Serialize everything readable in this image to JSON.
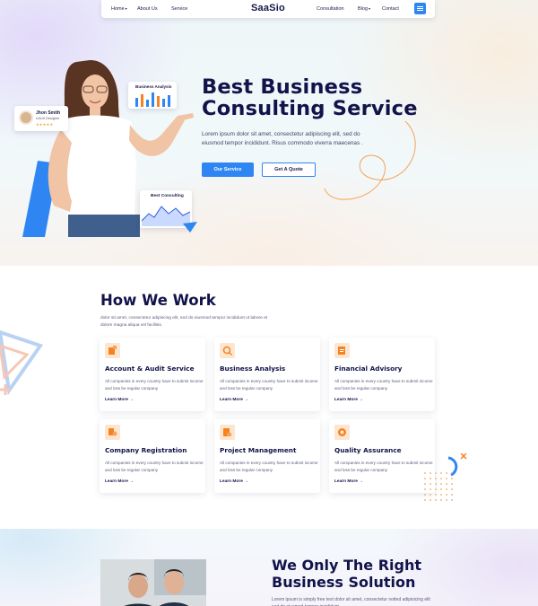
{
  "nav": {
    "items_left": [
      {
        "label": "Home",
        "caret": "▾"
      },
      {
        "label": "About Us",
        "caret": ""
      },
      {
        "label": "Service",
        "caret": ""
      }
    ],
    "logo": "SaaSio",
    "items_right": [
      {
        "label": "Consultation",
        "caret": ""
      },
      {
        "label": "Blog",
        "caret": "▾"
      },
      {
        "label": "Contact",
        "caret": ""
      }
    ],
    "menu_icon": "hamburger-icon"
  },
  "hero": {
    "title": "Best Business Consulting Service",
    "description": "Lorem ipsum dolor sit amet, consectetur adipiscing elit, sed do eiusmod tempor incididunt. Risus commodo viverra maecenas .",
    "primary_button": "Our Service",
    "secondary_button": "Get A Quote",
    "card_analysis_title": "Business Analysis",
    "card_user_name": "Jhon Smith",
    "card_user_role": "UI/UX Designer",
    "card_user_stars": "★★★★★",
    "card_consult_title": "Best Consulting"
  },
  "how_we_work": {
    "title": "How We Work",
    "description": "dolor sit amet, consectetur adipiscing elit, sed do eiusmod tempor incididunt ut labore et dolore magna aliqua vel facilisis.",
    "services": [
      {
        "title": "Account & Audit Service",
        "text": "All companies in every country have to submit income and loss be regular company",
        "link": "Learn More →",
        "icon": "invoice-icon"
      },
      {
        "title": "Business Analysis",
        "text": "All companies in every country have to submit income and loss be regular company",
        "link": "Learn More →",
        "icon": "analysis-icon"
      },
      {
        "title": "Financial Advisory",
        "text": "All companies in every country have to submit income and loss be regular company",
        "link": "Learn More →",
        "icon": "finance-icon"
      },
      {
        "title": "Company Registration",
        "text": "All companies in every country have to submit income and loss be regular company",
        "link": "Learn More →",
        "icon": "registration-icon"
      },
      {
        "title": "Project Management",
        "text": "All companies in every country have to submit income and loss be regular company",
        "link": "Learn More →",
        "icon": "project-icon"
      },
      {
        "title": "Quality Assurance",
        "text": "All companies in every country have to submit income and loss be regular company",
        "link": "Learn More →",
        "icon": "quality-icon"
      }
    ]
  },
  "solution": {
    "title": "We Only The Right Business Solution",
    "description": "Lorem ipsum is simply free text dolor sit amet, consectetur notted adipisicing elit sed do eiusmod tempor incididunt"
  },
  "colors": {
    "accent": "#2f86f3",
    "heading": "#12134a",
    "icon_bg": "#fde6cf",
    "icon_fg": "#f5821f",
    "star": "#f59b23"
  }
}
